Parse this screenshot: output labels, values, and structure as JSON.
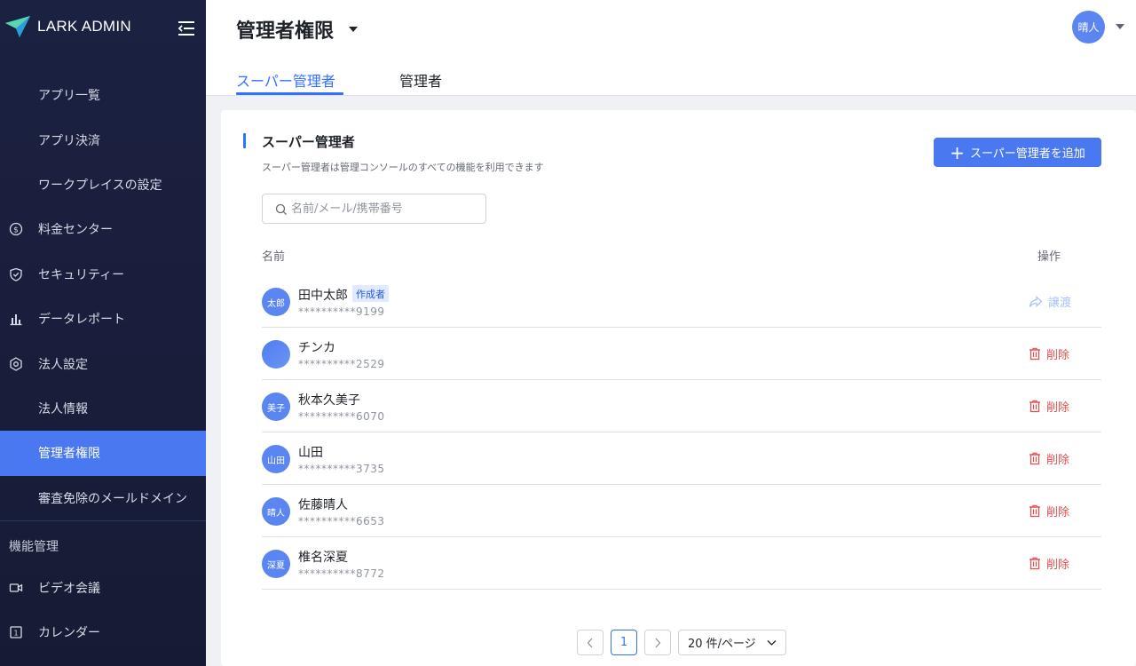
{
  "brand": {
    "name": "LARK ADMIN"
  },
  "sidebar": {
    "items": [
      {
        "label": "アプリ一覧",
        "icon": ""
      },
      {
        "label": "アプリ決済",
        "icon": ""
      },
      {
        "label": "ワークプレイスの設定",
        "icon": ""
      },
      {
        "label": "料金センター",
        "icon": "dollar-circle-icon"
      },
      {
        "label": "セキュリティー",
        "icon": "shield-check-icon"
      },
      {
        "label": "データレポート",
        "icon": "bar-chart-icon"
      },
      {
        "label": "法人設定",
        "icon": "hexagon-gear-icon"
      },
      {
        "label": "法人情報",
        "icon": ""
      },
      {
        "label": "管理者権限",
        "icon": "",
        "active": true
      },
      {
        "label": "審査免除のメールドメイン",
        "icon": ""
      }
    ],
    "section": "機能管理",
    "section_items": [
      {
        "label": "ビデオ会議",
        "icon": "video-camera-icon"
      },
      {
        "label": "カレンダー",
        "icon": "calendar-icon"
      }
    ]
  },
  "header": {
    "title": "管理者権限",
    "user_avatar": "晴人",
    "tabs": [
      {
        "label": "スーパー管理者",
        "active": true
      },
      {
        "label": "管理者",
        "active": false
      }
    ]
  },
  "card": {
    "title": "スーパー管理者",
    "description": "スーパー管理者は管理コンソールのすべての機能を利用できます",
    "add_button": "スーパー管理者を追加",
    "search_placeholder": "名前/メール/携帯番号",
    "columns": {
      "name": "名前",
      "operation": "操作"
    }
  },
  "admins": [
    {
      "avatar": "太郎",
      "name": "田中太郎",
      "badge": "作成者",
      "phone": "**********9199",
      "action": "譲渡",
      "action_type": "transfer"
    },
    {
      "avatar": "",
      "name": "チンカ",
      "badge": "",
      "phone": "**********2529",
      "action": "削除",
      "action_type": "delete"
    },
    {
      "avatar": "美子",
      "name": "秋本久美子",
      "badge": "",
      "phone": "**********6070",
      "action": "削除",
      "action_type": "delete"
    },
    {
      "avatar": "山田",
      "name": "山田",
      "badge": "",
      "phone": "**********3735",
      "action": "削除",
      "action_type": "delete"
    },
    {
      "avatar": "晴人",
      "name": "佐藤晴人",
      "badge": "",
      "phone": "**********6653",
      "action": "削除",
      "action_type": "delete"
    },
    {
      "avatar": "深夏",
      "name": "椎名深夏",
      "badge": "",
      "phone": "**********8772",
      "action": "削除",
      "action_type": "delete"
    }
  ],
  "pagination": {
    "current_page": "1",
    "page_size": "20 件/ページ"
  },
  "colors": {
    "accent": "#3370ff",
    "sidebar_bg": "#1b2141",
    "active_nav": "#4a78f0",
    "danger": "#e54f4f"
  }
}
